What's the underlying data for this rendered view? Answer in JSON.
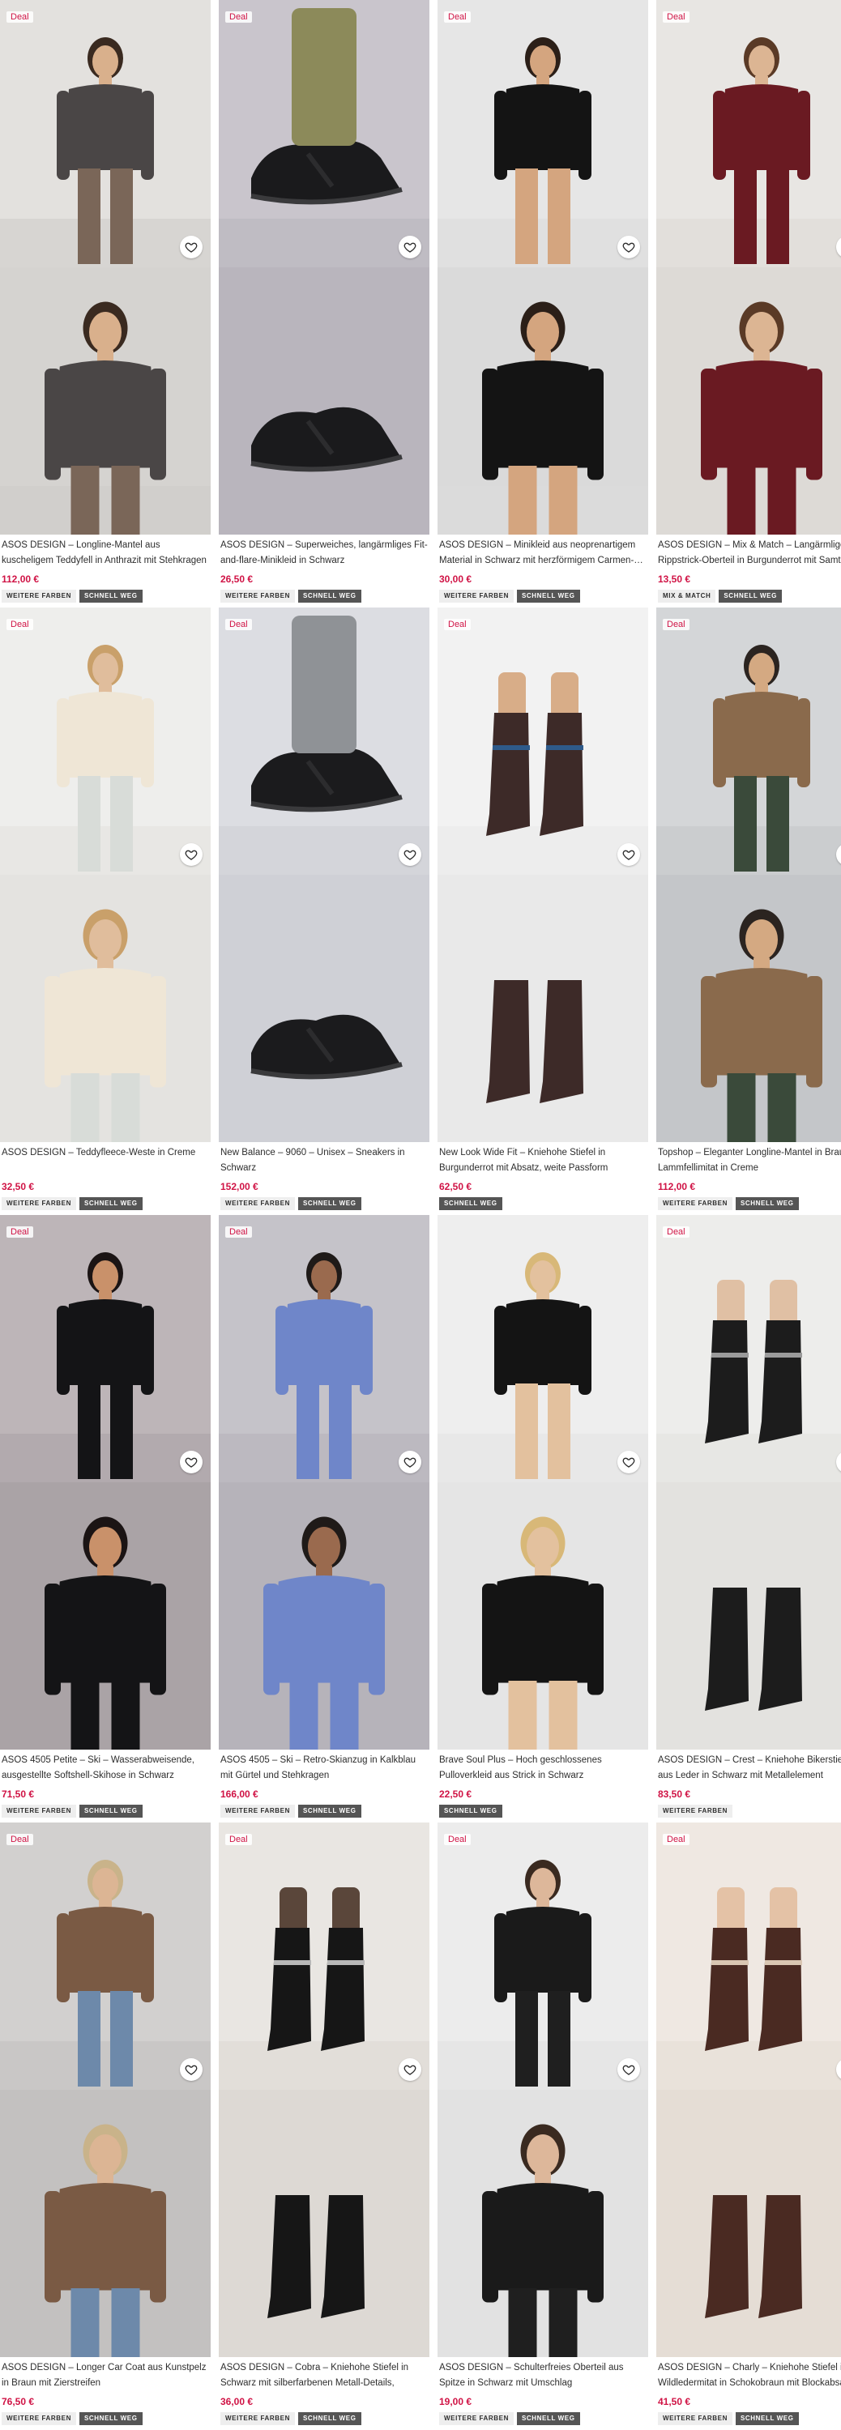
{
  "labels": {
    "deal": "Deal",
    "more_colours": "WEITERE FARBEN",
    "quick_buy": "SCHNELL WEG",
    "mix_match": "MIX & MATCH"
  },
  "icons": {
    "wishlist": "heart-outline-icon"
  },
  "colors": {
    "price": "#d01345",
    "badge_dark": "#555555",
    "badge_light": "#eeeeee"
  },
  "products": [
    {
      "title": "ASOS DESIGN – Longline-Mantel aus kuscheligem Teddyfell in Anthrazit mit Stehkragen",
      "price": "112,00 €",
      "deal": true,
      "badges": [
        "more_colours",
        "quick_buy"
      ],
      "art": {
        "bg": "#e3e1de",
        "bg2": "#d5d3d0",
        "garment": "#4a4646",
        "accent": "#5a2d2a",
        "skin": "#d9b08c",
        "hair": "#3a2a20",
        "lower": "#7a6658",
        "floor": "#cfcdca"
      }
    },
    {
      "title": "ASOS DESIGN – Superweiches, langärmliges Fit-and-flare-Minikleid in Schwarz",
      "price": "26,50 €",
      "deal": true,
      "badges": [
        "more_colours",
        "quick_buy"
      ],
      "art": {
        "bg": "#c9c5cc",
        "bg2": "#b9b5bd",
        "garment": "#1a1a1c",
        "accent": "#8c8a5a",
        "skin": "#c99672",
        "hair": "#1a1414",
        "lower": "#c99672",
        "floor": "#b9b5bd"
      }
    },
    {
      "title": "ASOS DESIGN – Minikleid aus neoprenartigem Material in Schwarz mit herzförmigem Carmen-…",
      "price": "30,00 €",
      "deal": true,
      "badges": [
        "more_colours",
        "quick_buy"
      ],
      "art": {
        "bg": "#e6e6e6",
        "bg2": "#dadada",
        "garment": "#141414",
        "accent": "#2a2a2a",
        "skin": "#d4a57f",
        "hair": "#2b1f18",
        "lower": "#d4a57f",
        "floor": "#dcdcdc"
      }
    },
    {
      "title": "ASOS DESIGN – Mix & Match – Langärmliges Rippstrick-Oberteil in Burgunderrot mit Samt-Be…",
      "price": "13,50 €",
      "deal": true,
      "badges": [
        "mix_match",
        "quick_buy"
      ],
      "art": {
        "bg": "#e8e6e3",
        "bg2": "#dddad6",
        "garment": "#6a1a22",
        "accent": "#5a141c",
        "skin": "#dcb593",
        "hair": "#5a3a26",
        "lower": "#6a1a22",
        "floor": "#dddad6"
      }
    },
    {
      "title": "ASOS DESIGN – Teddyfleece-Weste in Creme",
      "price": "32,50 €",
      "deal": true,
      "badges": [
        "more_colours",
        "quick_buy"
      ],
      "art": {
        "bg": "#eeeeec",
        "bg2": "#e4e3e0",
        "garment": "#efe6d6",
        "accent": "#3a3a3a",
        "skin": "#e0bd9c",
        "hair": "#c9a06a",
        "lower": "#d8dcd8",
        "floor": "#e4e3e0"
      }
    },
    {
      "title": "New Balance – 9060 – Unisex – Sneakers in Schwarz",
      "price": "152,00 €",
      "deal": true,
      "badges": [
        "more_colours",
        "quick_buy"
      ],
      "art": {
        "bg": "#dcdde2",
        "bg2": "#cfd0d6",
        "garment": "#1b1b1d",
        "accent": "#8f9296",
        "skin": "#8f9296",
        "hair": "#8f9296",
        "lower": "#8f9296",
        "floor": "#cfd0d6"
      }
    },
    {
      "title": "New Look Wide Fit – Kniehohe Stiefel in Burgunderrot mit Absatz, weite Passform",
      "price": "62,50 €",
      "deal": true,
      "badges": [
        "quick_buy"
      ],
      "art": {
        "bg": "#f2f2f2",
        "bg2": "#e9e9e9",
        "garment": "#3d2a28",
        "accent": "#2e5a8a",
        "skin": "#d8ad88",
        "hair": "#3d2a28",
        "lower": "#3d2a28",
        "floor": "#e9e9e9"
      }
    },
    {
      "title": "Topshop – Eleganter Longline-Mantel in Braun Lammfellimitat in Creme",
      "price": "112,00 €",
      "deal": true,
      "badges": [
        "more_colours",
        "quick_buy"
      ],
      "art": {
        "bg": "#d4d6d8",
        "bg2": "#c4c6c9",
        "garment": "#8a6a4c",
        "accent": "#ece3d2",
        "skin": "#d4a982",
        "hair": "#2b2420",
        "lower": "#3a4a3a",
        "floor": "#c4c6c9"
      }
    },
    {
      "title": "ASOS 4505 Petite – Ski – Wasserabweisende, ausgestellte Softshell-Skihose in Schwarz",
      "price": "71,50 €",
      "deal": true,
      "badges": [
        "more_colours",
        "quick_buy"
      ],
      "art": {
        "bg": "#bdb5b8",
        "bg2": "#aaa3a6",
        "garment": "#141416",
        "accent": "#6a3a2e",
        "skin": "#c9916a",
        "hair": "#1b1414",
        "lower": "#141416",
        "floor": "#aaa3a6"
      }
    },
    {
      "title": "ASOS 4505 – Ski – Retro-Skianzug in Kalkblau mit Gürtel und Stehkragen",
      "price": "166,00 €",
      "deal": true,
      "badges": [
        "more_colours",
        "quick_buy"
      ],
      "art": {
        "bg": "#c5c3c9",
        "bg2": "#b6b3ba",
        "garment": "#6f86c9",
        "accent": "#2b2222",
        "skin": "#9a6a4e",
        "hair": "#1f1a18",
        "lower": "#6f86c9",
        "floor": "#b6b3ba"
      }
    },
    {
      "title": "Brave Soul Plus – Hoch geschlossenes Pulloverkleid aus Strick in Schwarz",
      "price": "22,50 €",
      "deal": false,
      "badges": [
        "quick_buy"
      ],
      "art": {
        "bg": "#eeeeee",
        "bg2": "#e5e5e5",
        "garment": "#141414",
        "accent": "#1a1a1a",
        "skin": "#e3c19e",
        "hair": "#d8b878",
        "lower": "#e3c19e",
        "floor": "#e5e5e5"
      }
    },
    {
      "title": "ASOS DESIGN – Crest – Kniehohe Bikerstiefel aus Leder in Schwarz mit Metallelement",
      "price": "83,50 €",
      "deal": true,
      "badges": [
        "more_colours"
      ],
      "art": {
        "bg": "#ededeb",
        "bg2": "#e3e2df",
        "garment": "#1c1c1c",
        "accent": "#9a9a9a",
        "skin": "#e0c0a4",
        "hair": "#1c1c1c",
        "lower": "#1c1c1c",
        "floor": "#e3e2df"
      }
    },
    {
      "title": "ASOS DESIGN – Longer Car Coat aus Kunstpelz in Braun mit Zierstreifen",
      "price": "76,50 €",
      "deal": true,
      "badges": [
        "more_colours",
        "quick_buy"
      ],
      "art": {
        "bg": "#d2d0cf",
        "bg2": "#c3c1c0",
        "garment": "#7a5a44",
        "accent": "#6d89aa",
        "skin": "#dcb594",
        "hair": "#c9b38a",
        "lower": "#6d89aa",
        "floor": "#c3c1c0"
      }
    },
    {
      "title": "ASOS DESIGN – Cobra – Kniehohe Stiefel in Schwarz mit silberfarbenen Metall-Details, Gurten…",
      "price": "36,00 €",
      "deal": true,
      "badges": [
        "more_colours",
        "quick_buy"
      ],
      "art": {
        "bg": "#e9e6e2",
        "bg2": "#ddd9d4",
        "garment": "#161616",
        "accent": "#b8b8b8",
        "skin": "#5a463a",
        "hair": "#161616",
        "lower": "#161616",
        "floor": "#ddd9d4"
      }
    },
    {
      "title": "ASOS DESIGN – Schulterfreies Oberteil aus Spitze in Schwarz mit Umschlag",
      "price": "19,00 €",
      "deal": true,
      "badges": [
        "more_colours",
        "quick_buy"
      ],
      "art": {
        "bg": "#ececec",
        "bg2": "#e2e2e2",
        "garment": "#1a1a1a",
        "accent": "#1f1f1f",
        "skin": "#ddb79a",
        "hair": "#3a2a20",
        "lower": "#1f1f1f",
        "floor": "#e2e2e2"
      }
    },
    {
      "title": "ASOS DESIGN – Charly – Kniehohe Stiefel in Wildledermitat in Schokobraun mit Blockabsatz",
      "price": "41,50 €",
      "deal": true,
      "badges": [
        "more_colours",
        "quick_buy"
      ],
      "art": {
        "bg": "#efe8e2",
        "bg2": "#e5ddd5",
        "garment": "#4a2a22",
        "accent": "#d9c6b2",
        "skin": "#e4c2a6",
        "hair": "#4a2a22",
        "lower": "#4a2a22",
        "floor": "#e5ddd5"
      }
    }
  ]
}
